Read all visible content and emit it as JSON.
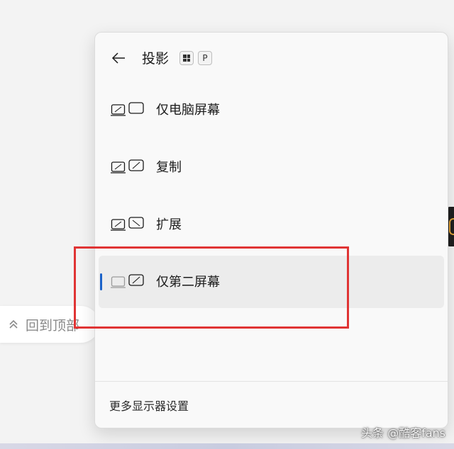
{
  "back_to_top": {
    "label": "回到顶部"
  },
  "flyout": {
    "title": "投影",
    "shortcut": {
      "key": "P"
    },
    "options": [
      {
        "label": "仅电脑屏幕",
        "selected": false
      },
      {
        "label": "复制",
        "selected": false
      },
      {
        "label": "扩展",
        "selected": false
      },
      {
        "label": "仅第二屏幕",
        "selected": true
      }
    ],
    "footer_link": "更多显示器设置"
  },
  "colors": {
    "accent": "#1b62c9",
    "annotation": "#e03434"
  },
  "icons": {
    "back": "arrow-left-icon",
    "windows_key": "windows-key-icon",
    "pc_screen_only": "pc-screen-only-icon",
    "duplicate": "duplicate-icon",
    "extend": "extend-icon",
    "second_screen_only": "second-screen-only-icon",
    "back_to_top": "chevron-up-double-icon"
  },
  "watermark": "头条 @酷客fans"
}
